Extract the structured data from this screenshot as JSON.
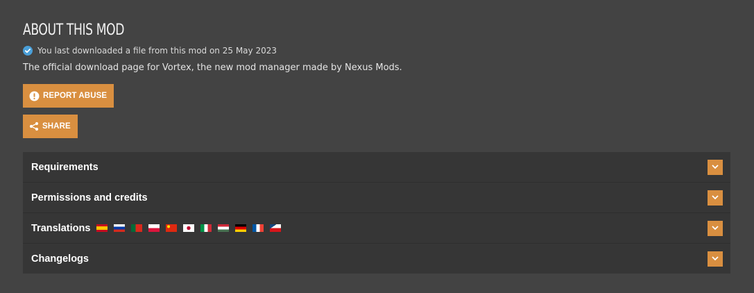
{
  "section": {
    "title": "ABOUT THIS MOD",
    "download_note": "You last downloaded a file from this mod on 25 May 2023",
    "description": "The official download page for Vortex, the new mod manager made by Nexus Mods."
  },
  "buttons": {
    "report_label": "REPORT ABUSE",
    "share_label": "SHARE"
  },
  "accordion": {
    "items": [
      {
        "label": "Requirements"
      },
      {
        "label": "Permissions and credits"
      },
      {
        "label": "Translations"
      },
      {
        "label": "Changelogs"
      }
    ],
    "translation_flags": [
      "spanish-flag",
      "russian-flag",
      "portuguese-flag",
      "polish-flag",
      "chinese-flag",
      "japanese-flag",
      "italian-flag",
      "hungarian-flag",
      "german-flag",
      "french-flag",
      "czech-flag"
    ]
  },
  "colors": {
    "background": "#434343",
    "panel": "#363636",
    "accent": "#d98f40",
    "check": "#4a9fd8"
  }
}
